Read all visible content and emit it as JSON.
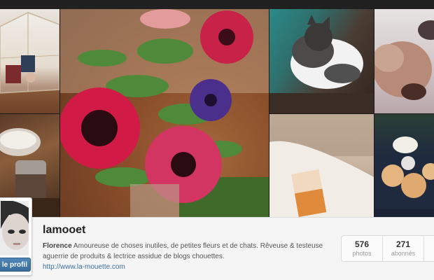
{
  "profile": {
    "username": "lamooet",
    "bio_name": "Florence",
    "bio_text": " Amoureuse de choses inutiles, de petites fleurs et de chats. Rêveuse & testeuse aguerrie de produits & lectrice assidue de blogs chouettes.",
    "website": "http://www.la-mouette.com",
    "edit_button": "le profil"
  },
  "stats": [
    {
      "value": "576",
      "label": "photos"
    },
    {
      "value": "271",
      "label": "abonnés"
    }
  ],
  "colors": {
    "link": "#3b6fa0",
    "button": "#3a6d9c",
    "bar_bg": "#f5f5f5"
  }
}
